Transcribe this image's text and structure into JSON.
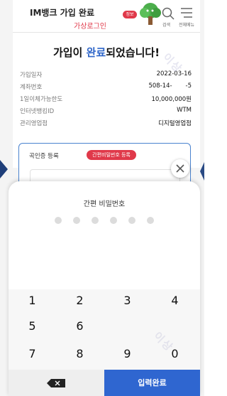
{
  "header": {
    "title": "IM뱅크 가입 완료",
    "subtitle": "가상로그인",
    "profile_badge": "정보",
    "search_label": "검색",
    "menu_label": "전체메뉴"
  },
  "result": {
    "title_prefix": "가입이 ",
    "title_highlight": "완료",
    "title_suffix": "되었습니다!",
    "rows": [
      {
        "label": "가입일자",
        "value": "2022-03-16"
      },
      {
        "label": "계좌번호",
        "value": "508-14-       -5"
      },
      {
        "label": "1일이체가능한도",
        "value": "10,000,000원"
      },
      {
        "label": "인터넷뱅킹ID",
        "value": "WTM"
      },
      {
        "label": "관리영업점",
        "value": "디지털영업점"
      }
    ]
  },
  "auth": {
    "title": "곡인증 등록",
    "badge": "간편비밀번호 등록"
  },
  "watermarks": [
    "이상",
    "이상"
  ],
  "pin": {
    "title": "간편 비밀번호",
    "digits_count": 6
  },
  "keypad": {
    "keys": [
      "1",
      "2",
      "3",
      "4",
      "5",
      "6",
      "7",
      "8",
      "9",
      "0"
    ],
    "submit_label": "입력완료"
  },
  "icons": {
    "close": "close-icon",
    "backspace": "backspace-icon",
    "search": "search-icon",
    "menu": "menu-icon"
  },
  "colors": {
    "accent": "#2f66d0",
    "badge": "#e0394a",
    "arrow": "#1f3f7a"
  }
}
